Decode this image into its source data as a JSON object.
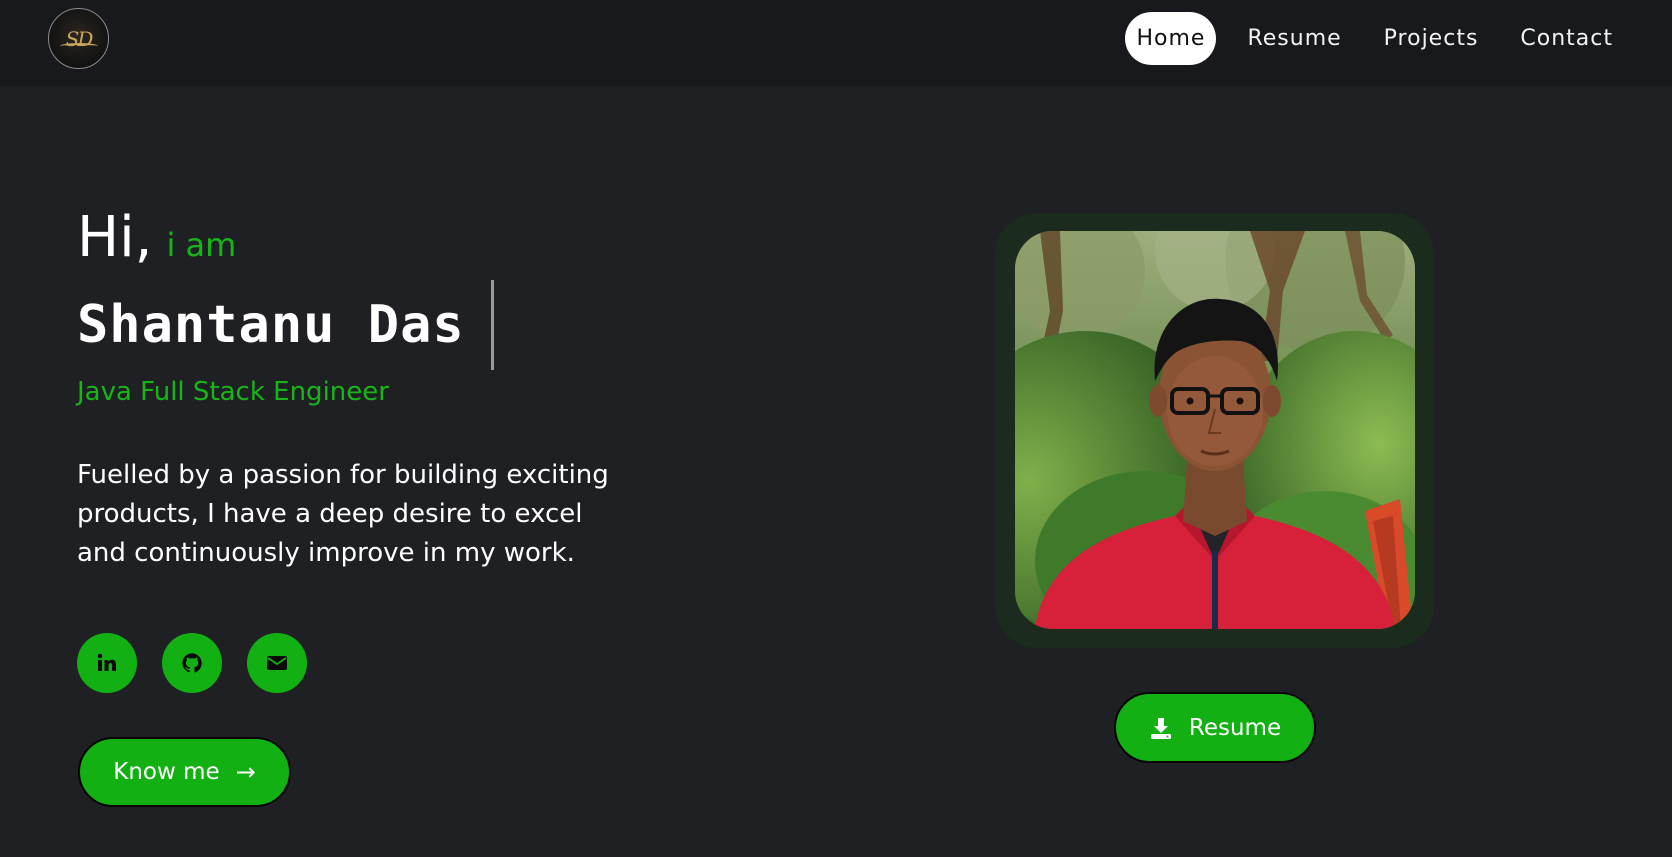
{
  "nav": {
    "logo_text": "SD",
    "links": [
      {
        "label": "Home",
        "active": true
      },
      {
        "label": "Resume",
        "active": false
      },
      {
        "label": "Projects",
        "active": false
      },
      {
        "label": "Contact",
        "active": false
      }
    ]
  },
  "hero": {
    "hi": "Hi,",
    "iam": "i am",
    "name": "Shantanu Das",
    "role": "Java Full Stack Engineer",
    "bio": "Fuelled by a passion for building exciting products, I have a deep desire to excel and continuously improve in my work.",
    "socials": [
      {
        "icon": "linkedin-icon",
        "label": "in"
      },
      {
        "icon": "github-icon"
      },
      {
        "icon": "email-icon"
      }
    ],
    "knowme_label": "Know me",
    "knowme_arrow": "→",
    "resume_label": "Resume"
  },
  "colors": {
    "accent": "#12b012",
    "background": "#1f2023",
    "navbar": "#18191d",
    "photo_frame": "#1b2b1e"
  }
}
